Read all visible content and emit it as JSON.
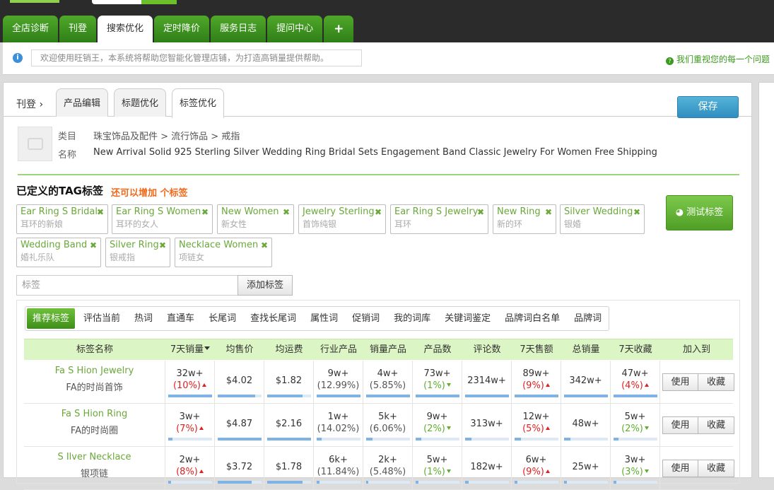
{
  "topnav": {
    "tabs": [
      "全店诊断",
      "刊登",
      "搜索优化",
      "定时降价",
      "服务日志",
      "提问中心",
      "+"
    ],
    "active": 2
  },
  "notice": {
    "text": "欢迎使用旺销王，本系统将帮助您智能化管理店铺，为打造高销量提供帮助。",
    "right": "我们重视您的每一个问题"
  },
  "breadcrumb": "刊登",
  "subtabs": [
    "产品编辑",
    "标题优化",
    "标签优化"
  ],
  "save_label": "保存",
  "product": {
    "category_label": "类目",
    "category": "珠宝饰品及配件 > 流行饰品 > 戒指",
    "name_label": "名称",
    "name": "New Arrival Solid 925 Sterling Silver Wedding Ring Bridal Sets Engagement Band Classic Jewelry For Women Free Shipping"
  },
  "tags_section": {
    "title": "已定义的TAG标签",
    "subtitle": "还可以增加  个标签",
    "test_label": "测试标签",
    "tags": [
      {
        "en": "Ear Ring S Bridal",
        "cn": "耳环的新娘"
      },
      {
        "en": "Ear Ring S Women",
        "cn": "耳环的女人"
      },
      {
        "en": "New Women",
        "cn": "新女性"
      },
      {
        "en": "Jewelry Sterling",
        "cn": "首饰纯银"
      },
      {
        "en": "Ear Ring S Jewelry",
        "cn": "耳环"
      },
      {
        "en": "New Ring",
        "cn": "新的环"
      },
      {
        "en": "Silver Wedding",
        "cn": "银婚"
      },
      {
        "en": "Wedding Band",
        "cn": "婚礼乐队"
      },
      {
        "en": "Silver Ring",
        "cn": "银戒指"
      },
      {
        "en": "Necklace Women",
        "cn": "项链女"
      }
    ]
  },
  "add_tag": {
    "placeholder": "标签",
    "button": "添加标签"
  },
  "rec_tabs": [
    "推荐标签",
    "评估当前",
    "热词",
    "直通车",
    "长尾词",
    "查找长尾词",
    "属性词",
    "促销词",
    "我的词库",
    "关键词鉴定",
    "品牌词白名单",
    "品牌词"
  ],
  "table": {
    "headers": [
      "标签名称",
      "7天销量",
      "均售价",
      "均运费",
      "行业产品",
      "销量产品",
      "产品数",
      "评论数",
      "7天售额",
      "总销量",
      "7天收藏",
      "加入到"
    ],
    "action_use": "使用",
    "action_fav": "收藏",
    "rows": [
      {
        "en": "Fa S Hion Jewelry",
        "cn": "FA的时尚首饰",
        "sales7": {
          "v": "32w+",
          "c": "(10%)",
          "dir": "up",
          "bar": 1.0
        },
        "price": {
          "v": "$4.02",
          "bar": 0.85
        },
        "ship": {
          "v": "$1.82",
          "bar": 0.8
        },
        "industry": {
          "v": "9w+",
          "c": "(12.99%)",
          "dir": "neutral",
          "bar": 1.0
        },
        "salesprod": {
          "v": "4w+",
          "c": "(5.85%)",
          "dir": "neutral",
          "bar": 1.0
        },
        "count": {
          "v": "73w+",
          "c": "(1%)",
          "dir": "down",
          "bar": 1.0
        },
        "reviews": {
          "v": "2314w+",
          "bar": 1.0
        },
        "amount7": {
          "v": "89w+",
          "c": "(9%)",
          "dir": "up",
          "bar": 1.0
        },
        "total": {
          "v": "342w+",
          "bar": 1.0
        },
        "fav7": {
          "v": "47w+",
          "c": "(4%)",
          "dir": "up",
          "bar": 1.0
        }
      },
      {
        "en": "Fa S Hion Ring",
        "cn": "FA的时尚圈",
        "sales7": {
          "v": "3w+",
          "c": "(7%)",
          "dir": "up",
          "bar": 0.1
        },
        "price": {
          "v": "$4.87",
          "bar": 1.0
        },
        "ship": {
          "v": "$2.16",
          "bar": 1.0
        },
        "industry": {
          "v": "1w+",
          "c": "(14.02%)",
          "dir": "neutral",
          "bar": 0.12
        },
        "salesprod": {
          "v": "5k+",
          "c": "(6.06%)",
          "dir": "neutral",
          "bar": 0.15
        },
        "count": {
          "v": "9w+",
          "c": "(2%)",
          "dir": "down",
          "bar": 0.13
        },
        "reviews": {
          "v": "313w+",
          "bar": 0.14
        },
        "amount7": {
          "v": "12w+",
          "c": "(5%)",
          "dir": "up",
          "bar": 0.14
        },
        "total": {
          "v": "48w+",
          "bar": 0.14
        },
        "fav7": {
          "v": "5w+",
          "c": "(2%)",
          "dir": "down",
          "bar": 0.11
        }
      },
      {
        "en": "S Ilver Necklace",
        "cn": "银项链",
        "sales7": {
          "v": "2w+",
          "c": "(8%)",
          "dir": "up",
          "bar": 0.07
        },
        "price": {
          "v": "$3.72",
          "bar": 0.77
        },
        "ship": {
          "v": "$1.78",
          "bar": 0.8
        },
        "industry": {
          "v": "6k+",
          "c": "(11.84%)",
          "dir": "neutral",
          "bar": 0.07
        },
        "salesprod": {
          "v": "2k+",
          "c": "(5.48%)",
          "dir": "neutral",
          "bar": 0.05
        },
        "count": {
          "v": "5w+",
          "c": "(1%)",
          "dir": "down",
          "bar": 0.07
        },
        "reviews": {
          "v": "182w+",
          "bar": 0.08
        },
        "amount7": {
          "v": "6w+",
          "c": "(9%)",
          "dir": "up",
          "bar": 0.07
        },
        "total": {
          "v": "25w+",
          "bar": 0.07
        },
        "fav7": {
          "v": "3w+",
          "c": "(3%)",
          "dir": "down",
          "bar": 0.06
        }
      }
    ]
  },
  "colors": {
    "brand_green": "#4fa82a",
    "tag_green": "#6aa83a",
    "increase_red": "#e02020",
    "decrease_green": "#5fae2e",
    "save_blue": "#2f8ec0"
  }
}
